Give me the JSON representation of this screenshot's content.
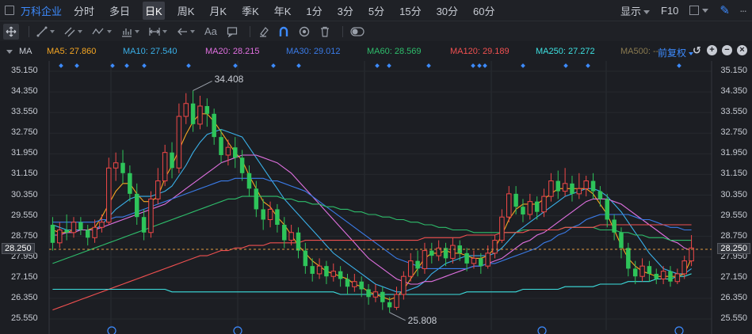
{
  "stock": {
    "name": "万科企业"
  },
  "periods": [
    "分时",
    "多日",
    "日K",
    "周K",
    "月K",
    "季K",
    "年K",
    "1分",
    "3分",
    "5分",
    "15分",
    "30分",
    "60分"
  ],
  "active_period": "日K",
  "top_right": {
    "display_label": "显示",
    "f10_label": "F10"
  },
  "toolbar": {
    "tools": [
      "move-icon",
      "line-icon",
      "channel-icon",
      "wave-icon",
      "chart-tool-icon",
      "range-icon",
      "arrow-left-icon",
      "text-icon",
      "note-icon",
      "eraser-icon",
      "magnet-icon",
      "eye-icon",
      "trash-icon",
      "toggle-icon"
    ],
    "text_tool_label": "Aa"
  },
  "ma_legend": {
    "label": "MA",
    "items": [
      {
        "text": "MA5: 27.860",
        "color": "#f5a623"
      },
      {
        "text": "MA10: 27.540",
        "color": "#3ab0e8"
      },
      {
        "text": "MA20: 28.215",
        "color": "#e070e0"
      },
      {
        "text": "MA30: 29.012",
        "color": "#3a7be8"
      },
      {
        "text": "MA60: 28.569",
        "color": "#2ebd6b"
      },
      {
        "text": "MA120: 29.189",
        "color": "#f05050"
      },
      {
        "text": "MA250: 27.272",
        "color": "#3de0e0"
      },
      {
        "text": "MA500: --",
        "color": "#8a7a50"
      }
    ],
    "adjust_label": "前复权"
  },
  "axis": {
    "ticks": [
      "35.150",
      "34.350",
      "33.550",
      "32.750",
      "31.950",
      "31.150",
      "30.350",
      "29.550",
      "28.750",
      "27.950",
      "27.150",
      "26.350",
      "25.550"
    ],
    "current_price": "28.250"
  },
  "chart_data": {
    "type": "candlestick",
    "ylim": [
      25.2,
      35.5
    ],
    "high_label": "34.408",
    "low_label": "25.808",
    "last_close": 28.25,
    "candles": [
      [
        29.2,
        28.5,
        29.5,
        28.2
      ],
      [
        28.5,
        29.0,
        29.3,
        28.3
      ],
      [
        29.0,
        28.9,
        29.6,
        28.6
      ],
      [
        28.9,
        29.3,
        29.5,
        28.7
      ],
      [
        29.3,
        29.0,
        29.5,
        28.8
      ],
      [
        29.0,
        28.7,
        29.2,
        28.4
      ],
      [
        28.7,
        29.1,
        29.4,
        28.5
      ],
      [
        29.1,
        29.3,
        29.6,
        28.9
      ],
      [
        29.3,
        31.4,
        31.8,
        29.2
      ],
      [
        31.4,
        31.6,
        32.0,
        30.9
      ],
      [
        31.6,
        31.2,
        32.1,
        30.8
      ],
      [
        31.2,
        30.4,
        31.5,
        30.1
      ],
      [
        30.4,
        29.5,
        30.8,
        29.2
      ],
      [
        29.5,
        28.9,
        29.8,
        28.6
      ],
      [
        28.9,
        30.2,
        30.5,
        28.7
      ],
      [
        30.2,
        30.9,
        31.4,
        30.0
      ],
      [
        30.9,
        32.0,
        32.3,
        30.7
      ],
      [
        32.0,
        31.4,
        32.4,
        31.0
      ],
      [
        31.4,
        33.4,
        33.9,
        31.2
      ],
      [
        33.4,
        33.9,
        34.3,
        33.1
      ],
      [
        33.9,
        33.1,
        34.4,
        32.8
      ],
      [
        33.1,
        33.8,
        34.2,
        32.9
      ],
      [
        33.8,
        33.5,
        34.1,
        33.0
      ],
      [
        33.5,
        32.6,
        33.7,
        32.3
      ],
      [
        32.6,
        31.9,
        32.9,
        31.6
      ],
      [
        31.9,
        32.2,
        32.5,
        31.5
      ],
      [
        32.2,
        31.8,
        32.6,
        31.4
      ],
      [
        31.8,
        31.2,
        32.1,
        30.9
      ],
      [
        31.2,
        30.6,
        31.5,
        30.3
      ],
      [
        30.6,
        29.8,
        30.9,
        29.5
      ],
      [
        29.8,
        29.4,
        30.2,
        29.0
      ],
      [
        29.4,
        29.8,
        30.1,
        29.1
      ],
      [
        29.8,
        29.2,
        30.0,
        28.9
      ],
      [
        29.2,
        28.6,
        29.5,
        28.3
      ],
      [
        28.6,
        28.9,
        29.2,
        28.4
      ],
      [
        28.9,
        28.2,
        29.1,
        27.9
      ],
      [
        28.2,
        27.6,
        28.5,
        27.3
      ],
      [
        27.6,
        27.3,
        27.9,
        27.0
      ],
      [
        27.3,
        27.6,
        27.9,
        27.1
      ],
      [
        27.6,
        27.2,
        27.8,
        26.9
      ],
      [
        27.2,
        27.4,
        27.7,
        27.0
      ],
      [
        27.4,
        27.1,
        27.6,
        26.8
      ],
      [
        27.1,
        26.8,
        27.3,
        26.5
      ],
      [
        26.8,
        27.0,
        27.3,
        26.6
      ],
      [
        27.0,
        26.7,
        27.2,
        26.4
      ],
      [
        26.7,
        26.4,
        26.9,
        26.1
      ],
      [
        26.4,
        26.6,
        26.9,
        26.2
      ],
      [
        26.6,
        26.2,
        26.8,
        25.9
      ],
      [
        26.2,
        26.0,
        26.4,
        25.8
      ],
      [
        26.0,
        26.5,
        26.8,
        25.9
      ],
      [
        26.5,
        27.2,
        27.4,
        26.3
      ],
      [
        27.2,
        27.8,
        28.1,
        27.0
      ],
      [
        27.8,
        27.5,
        28.2,
        27.2
      ],
      [
        27.5,
        28.2,
        28.5,
        27.3
      ],
      [
        28.2,
        28.0,
        28.5,
        27.7
      ],
      [
        28.0,
        28.3,
        28.6,
        27.8
      ],
      [
        28.3,
        27.9,
        28.5,
        27.6
      ],
      [
        27.9,
        28.4,
        28.7,
        27.7
      ],
      [
        28.4,
        28.1,
        28.6,
        27.8
      ],
      [
        28.1,
        27.7,
        28.3,
        27.4
      ],
      [
        27.7,
        27.9,
        28.2,
        27.5
      ],
      [
        27.9,
        27.6,
        28.1,
        27.3
      ],
      [
        27.6,
        28.1,
        28.4,
        27.5
      ],
      [
        28.1,
        28.6,
        28.8,
        27.9
      ],
      [
        28.6,
        29.5,
        29.8,
        28.5
      ],
      [
        29.5,
        30.4,
        30.7,
        29.3
      ],
      [
        30.4,
        29.9,
        30.7,
        29.6
      ],
      [
        29.9,
        29.6,
        30.2,
        29.3
      ],
      [
        29.6,
        30.1,
        30.4,
        29.4
      ],
      [
        30.1,
        29.7,
        30.3,
        29.4
      ],
      [
        29.7,
        30.3,
        30.6,
        29.5
      ],
      [
        30.3,
        30.9,
        31.2,
        30.1
      ],
      [
        30.9,
        30.5,
        31.3,
        30.2
      ],
      [
        30.5,
        30.8,
        31.4,
        30.3
      ],
      [
        30.8,
        30.4,
        31.1,
        30.1
      ],
      [
        30.4,
        30.6,
        31.2,
        30.2
      ],
      [
        30.6,
        30.9,
        31.1,
        30.3
      ],
      [
        30.9,
        30.5,
        31.2,
        30.2
      ],
      [
        30.5,
        30.2,
        30.7,
        29.9
      ],
      [
        30.2,
        29.4,
        30.4,
        29.1
      ],
      [
        29.4,
        28.9,
        29.6,
        28.6
      ],
      [
        28.9,
        28.3,
        29.1,
        27.9
      ],
      [
        28.3,
        27.5,
        28.5,
        27.2
      ],
      [
        27.5,
        27.2,
        27.8,
        26.9
      ],
      [
        27.2,
        27.6,
        27.9,
        27.0
      ],
      [
        27.6,
        27.3,
        27.8,
        27.0
      ],
      [
        27.3,
        27.1,
        27.5,
        26.9
      ],
      [
        27.1,
        27.4,
        27.6,
        26.9
      ],
      [
        27.4,
        27.0,
        27.6,
        26.8
      ],
      [
        27.0,
        27.3,
        27.5,
        26.9
      ],
      [
        27.3,
        27.8,
        28.0,
        27.1
      ],
      [
        27.8,
        28.3,
        28.8,
        27.6
      ]
    ],
    "series": [
      {
        "name": "MA5",
        "color": "#f5a623",
        "values": [
          29.0,
          28.9,
          28.9,
          29.0,
          29.0,
          29.0,
          29.1,
          29.5,
          30.0,
          30.5,
          30.8,
          30.8,
          30.4,
          30.1,
          30.1,
          30.3,
          31.0,
          31.5,
          32.1,
          32.7,
          33.2,
          33.5,
          33.5,
          33.2,
          32.8,
          32.4,
          32.0,
          31.7,
          31.1,
          30.6,
          30.1,
          29.9,
          29.5,
          29.2,
          28.8,
          28.4,
          28.1,
          27.8,
          27.6,
          27.4,
          27.3,
          27.2,
          27.1,
          26.9,
          26.8,
          26.6,
          26.5,
          26.4,
          26.3,
          26.4,
          26.7,
          27.1,
          27.5,
          27.9,
          28.1,
          28.1,
          28.2,
          28.1,
          28.1,
          28.0,
          27.9,
          27.9,
          28.0,
          28.3,
          28.8,
          29.4,
          29.8,
          30.0,
          30.0,
          30.0,
          30.2,
          30.4,
          30.6,
          30.6,
          30.6,
          30.6,
          30.6,
          30.4,
          30.0,
          29.6,
          29.0,
          28.4,
          27.9,
          27.6,
          27.4,
          27.3,
          27.2,
          27.2,
          27.2,
          27.2,
          27.3,
          27.9
        ]
      },
      {
        "name": "MA10",
        "color": "#3ab0e8",
        "values": [
          29.2,
          29.1,
          29.0,
          29.0,
          29.0,
          29.0,
          29.0,
          29.2,
          29.5,
          29.8,
          30.0,
          30.2,
          30.3,
          30.3,
          30.3,
          30.4,
          30.5,
          30.7,
          31.1,
          31.5,
          32.0,
          32.4,
          32.7,
          32.8,
          32.9,
          32.8,
          32.7,
          32.6,
          32.2,
          31.8,
          31.4,
          31.0,
          30.6,
          30.2,
          29.9,
          29.6,
          29.3,
          29.0,
          28.7,
          28.4,
          28.1,
          27.9,
          27.7,
          27.5,
          27.3,
          27.1,
          26.9,
          26.8,
          26.7,
          26.6,
          26.6,
          26.7,
          26.8,
          27.0,
          27.3,
          27.5,
          27.7,
          27.8,
          27.9,
          28.0,
          28.0,
          28.0,
          28.0,
          28.1,
          28.3,
          28.6,
          28.9,
          29.1,
          29.3,
          29.5,
          29.7,
          29.9,
          30.1,
          30.3,
          30.4,
          30.5,
          30.6,
          30.6,
          30.5,
          30.3,
          30.0,
          29.7,
          29.3,
          28.9,
          28.5,
          28.1,
          27.8,
          27.5,
          27.4,
          27.3,
          27.3,
          27.5
        ]
      },
      {
        "name": "MA20",
        "color": "#e070e0",
        "values": [
          28.8,
          28.8,
          28.9,
          28.9,
          29.0,
          29.0,
          29.0,
          29.1,
          29.2,
          29.3,
          29.4,
          29.5,
          29.6,
          29.7,
          29.8,
          29.9,
          30.0,
          30.2,
          30.4,
          30.6,
          30.8,
          31.0,
          31.2,
          31.4,
          31.6,
          31.7,
          31.8,
          31.9,
          31.9,
          31.9,
          31.8,
          31.7,
          31.6,
          31.4,
          31.2,
          30.9,
          30.6,
          30.3,
          30.0,
          29.7,
          29.4,
          29.1,
          28.8,
          28.5,
          28.2,
          27.9,
          27.7,
          27.5,
          27.3,
          27.1,
          27.0,
          26.9,
          26.9,
          27.0,
          27.0,
          27.1,
          27.2,
          27.3,
          27.4,
          27.5,
          27.6,
          27.6,
          27.7,
          27.8,
          27.9,
          28.1,
          28.3,
          28.5,
          28.6,
          28.8,
          28.9,
          29.1,
          29.3,
          29.5,
          29.7,
          29.9,
          30.1,
          30.2,
          30.2,
          30.2,
          30.1,
          30.0,
          29.8,
          29.6,
          29.4,
          29.2,
          29.0,
          28.8,
          28.6,
          28.5,
          28.3,
          28.2
        ]
      },
      {
        "name": "MA30",
        "color": "#3a7be8",
        "values": [
          29.3,
          29.3,
          29.3,
          29.3,
          29.3,
          29.3,
          29.3,
          29.4,
          29.4,
          29.5,
          29.5,
          29.6,
          29.7,
          29.8,
          29.9,
          30.0,
          30.1,
          30.2,
          30.3,
          30.4,
          30.5,
          30.6,
          30.7,
          30.8,
          30.9,
          30.9,
          31.0,
          31.0,
          31.0,
          31.0,
          31.0,
          30.9,
          30.9,
          30.8,
          30.7,
          30.6,
          30.5,
          30.3,
          30.1,
          29.9,
          29.7,
          29.5,
          29.3,
          29.1,
          28.9,
          28.7,
          28.5,
          28.3,
          28.1,
          27.9,
          27.8,
          27.7,
          27.6,
          27.5,
          27.5,
          27.5,
          27.5,
          27.5,
          27.5,
          27.5,
          27.6,
          27.6,
          27.7,
          27.7,
          27.8,
          27.9,
          28.0,
          28.1,
          28.2,
          28.3,
          28.5,
          28.6,
          28.8,
          28.9,
          29.1,
          29.2,
          29.4,
          29.5,
          29.6,
          29.6,
          29.6,
          29.6,
          29.6,
          29.5,
          29.4,
          29.4,
          29.3,
          29.2,
          29.1,
          29.1,
          29.0,
          29.0
        ]
      },
      {
        "name": "MA60",
        "color": "#2ebd6b",
        "values": [
          27.7,
          27.8,
          27.9,
          28.0,
          28.1,
          28.2,
          28.3,
          28.4,
          28.5,
          28.6,
          28.7,
          28.8,
          28.9,
          29.0,
          29.1,
          29.2,
          29.3,
          29.4,
          29.5,
          29.6,
          29.7,
          29.8,
          29.9,
          30.0,
          30.1,
          30.2,
          30.2,
          30.3,
          30.3,
          30.3,
          30.3,
          30.3,
          30.3,
          30.2,
          30.2,
          30.1,
          30.1,
          30.0,
          30.0,
          29.9,
          29.9,
          29.8,
          29.8,
          29.7,
          29.7,
          29.6,
          29.6,
          29.5,
          29.5,
          29.4,
          29.4,
          29.3,
          29.3,
          29.2,
          29.2,
          29.1,
          29.1,
          29.0,
          29.0,
          29.0,
          28.9,
          28.9,
          28.9,
          28.9,
          28.9,
          28.9,
          28.9,
          29.0,
          29.0,
          29.0,
          29.0,
          29.0,
          29.0,
          29.1,
          29.1,
          29.1,
          29.1,
          29.1,
          29.0,
          29.0,
          29.0,
          28.9,
          28.9,
          28.8,
          28.8,
          28.7,
          28.7,
          28.7,
          28.6,
          28.6,
          28.6,
          28.6
        ]
      },
      {
        "name": "MA120",
        "color": "#f05050",
        "values": [
          25.9,
          26.0,
          26.1,
          26.2,
          26.3,
          26.4,
          26.5,
          26.6,
          26.7,
          26.8,
          26.9,
          27.0,
          27.1,
          27.2,
          27.3,
          27.4,
          27.5,
          27.6,
          27.7,
          27.8,
          27.9,
          28.0,
          28.0,
          28.1,
          28.2,
          28.2,
          28.3,
          28.3,
          28.4,
          28.4,
          28.4,
          28.5,
          28.5,
          28.5,
          28.5,
          28.5,
          28.6,
          28.6,
          28.6,
          28.6,
          28.6,
          28.6,
          28.6,
          28.6,
          28.6,
          28.6,
          28.6,
          28.6,
          28.6,
          28.6,
          28.6,
          28.6,
          28.6,
          28.7,
          28.7,
          28.7,
          28.7,
          28.7,
          28.7,
          28.8,
          28.8,
          28.8,
          28.8,
          28.8,
          28.9,
          28.9,
          28.9,
          28.9,
          29.0,
          29.0,
          29.0,
          29.0,
          29.0,
          29.1,
          29.1,
          29.1,
          29.1,
          29.1,
          29.2,
          29.2,
          29.2,
          29.2,
          29.2,
          29.2,
          29.2,
          29.2,
          29.2,
          29.2,
          29.2,
          29.2,
          29.2,
          29.2
        ]
      },
      {
        "name": "MA250",
        "color": "#3de0e0",
        "values": [
          26.7,
          26.7,
          26.7,
          26.7,
          26.7,
          26.7,
          26.7,
          26.7,
          26.7,
          26.7,
          26.7,
          26.7,
          26.7,
          26.7,
          26.7,
          26.7,
          26.7,
          26.6,
          26.6,
          26.6,
          26.6,
          26.6,
          26.6,
          26.6,
          26.6,
          26.6,
          26.6,
          26.6,
          26.6,
          26.6,
          26.6,
          26.6,
          26.6,
          26.6,
          26.6,
          26.6,
          26.6,
          26.6,
          26.6,
          26.6,
          26.6,
          26.5,
          26.5,
          26.5,
          26.5,
          26.5,
          26.5,
          26.5,
          26.5,
          26.5,
          26.5,
          26.5,
          26.5,
          26.5,
          26.5,
          26.5,
          26.5,
          26.5,
          26.5,
          26.6,
          26.6,
          26.6,
          26.6,
          26.6,
          26.6,
          26.6,
          26.6,
          26.7,
          26.7,
          26.7,
          26.7,
          26.7,
          26.7,
          26.8,
          26.8,
          26.8,
          26.8,
          26.8,
          26.9,
          26.9,
          26.9,
          26.9,
          27.0,
          27.0,
          27.0,
          27.0,
          27.1,
          27.1,
          27.1,
          27.2,
          27.2,
          27.3
        ]
      }
    ]
  }
}
